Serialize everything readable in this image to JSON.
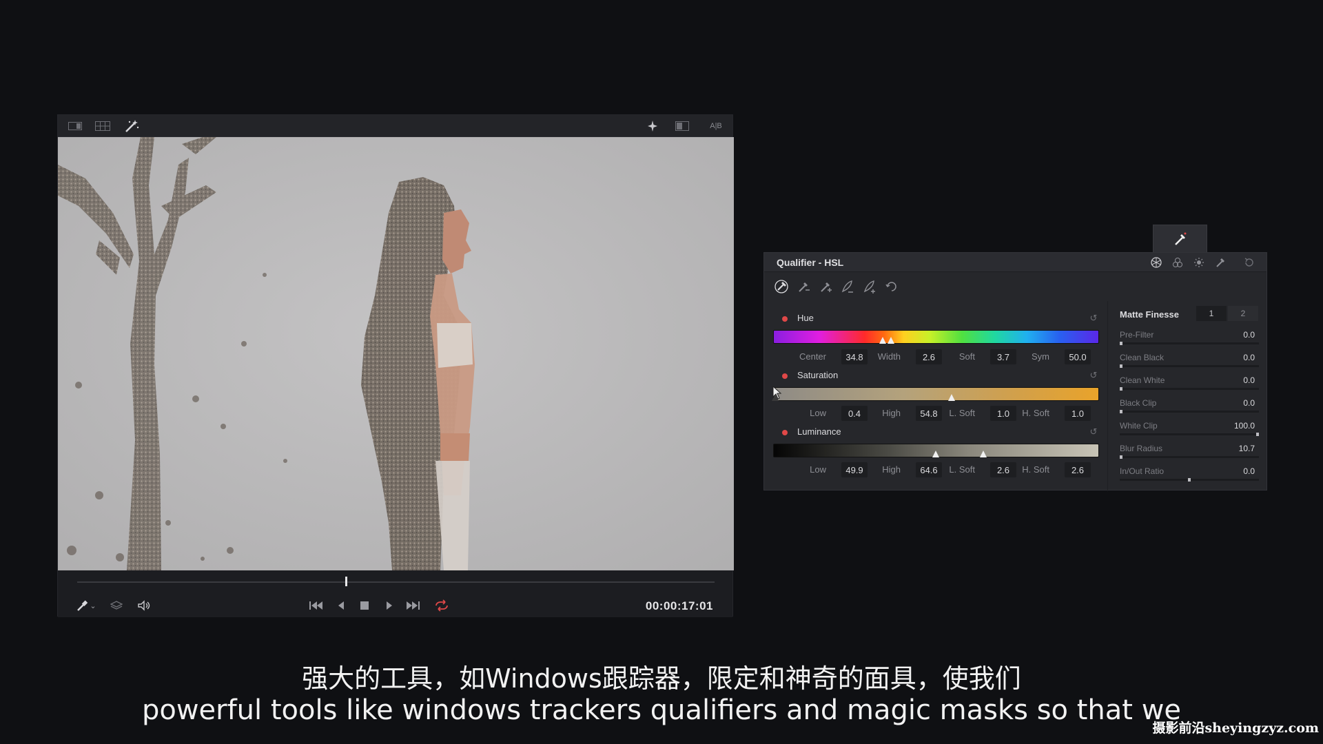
{
  "viewer": {
    "toolbar_left_icons": [
      "single-viewer-icon",
      "grid-view-icon",
      "magic-wand-icon"
    ],
    "toolbar_right_icons": [
      "highlight-icon",
      "split-view-icon"
    ],
    "ab_label": "A|B",
    "playhead_fraction": 0.42,
    "timecode": "00:00:17:01",
    "transport_left_icons": [
      "color-picker-icon",
      "chevron-down-icon",
      "layers-icon",
      "volume-icon"
    ],
    "transport_buttons": [
      "skip-to-start-icon",
      "step-back-icon",
      "stop-icon",
      "play-icon",
      "skip-to-end-icon",
      "loop-icon"
    ],
    "loop_color": "#e04848"
  },
  "qualifier": {
    "title": "Qualifier - HSL",
    "header_icons": [
      "hsl-icon",
      "rgb-icon",
      "luminance-icon",
      "3d-picker-icon",
      "reset-icon"
    ],
    "tools": [
      "picker-icon",
      "picker-minus-icon",
      "picker-plus-icon",
      "feather-minus-icon",
      "feather-plus-icon",
      "invert-icon"
    ],
    "hue": {
      "label": "Hue",
      "params": [
        {
          "label": "Center",
          "value": "34.8"
        },
        {
          "label": "Width",
          "value": "2.6"
        },
        {
          "label": "Soft",
          "value": "3.7"
        },
        {
          "label": "Sym",
          "value": "50.0"
        }
      ],
      "handle_fractions": [
        0.335,
        0.36
      ]
    },
    "saturation": {
      "label": "Saturation",
      "params": [
        {
          "label": "Low",
          "value": "0.4"
        },
        {
          "label": "High",
          "value": "54.8"
        },
        {
          "label": "L. Soft",
          "value": "1.0"
        },
        {
          "label": "H. Soft",
          "value": "1.0"
        }
      ],
      "handle_fractions": [
        0.004,
        0.548
      ]
    },
    "luminance": {
      "label": "Luminance",
      "params": [
        {
          "label": "Low",
          "value": "49.9"
        },
        {
          "label": "High",
          "value": "64.6"
        },
        {
          "label": "L. Soft",
          "value": "2.6"
        },
        {
          "label": "H. Soft",
          "value": "2.6"
        }
      ],
      "handle_fractions": [
        0.499,
        0.646
      ]
    },
    "matte_finesse": {
      "title": "Matte Finesse",
      "tabs": [
        "1",
        "2"
      ],
      "rows": [
        {
          "label": "Pre-Filter",
          "value": "0.0",
          "fraction": 0.0
        },
        {
          "label": "Clean Black",
          "value": "0.0",
          "fraction": 0.0
        },
        {
          "label": "Clean White",
          "value": "0.0",
          "fraction": 0.0
        },
        {
          "label": "Black Clip",
          "value": "0.0",
          "fraction": 0.0
        },
        {
          "label": "White Clip",
          "value": "100.0",
          "fraction": 1.0
        },
        {
          "label": "Blur Radius",
          "value": "10.7",
          "fraction": 0.0
        },
        {
          "label": "In/Out Ratio",
          "value": "0.0",
          "fraction": 0.5
        }
      ]
    }
  },
  "subtitles": {
    "chinese": "强大的工具，如Windows跟踪器，限定和神奇的面具，使我们",
    "english": "powerful tools like windows trackers qualifiers and magic masks so that we"
  },
  "watermark": "摄影前沿sheyingzyz.com"
}
